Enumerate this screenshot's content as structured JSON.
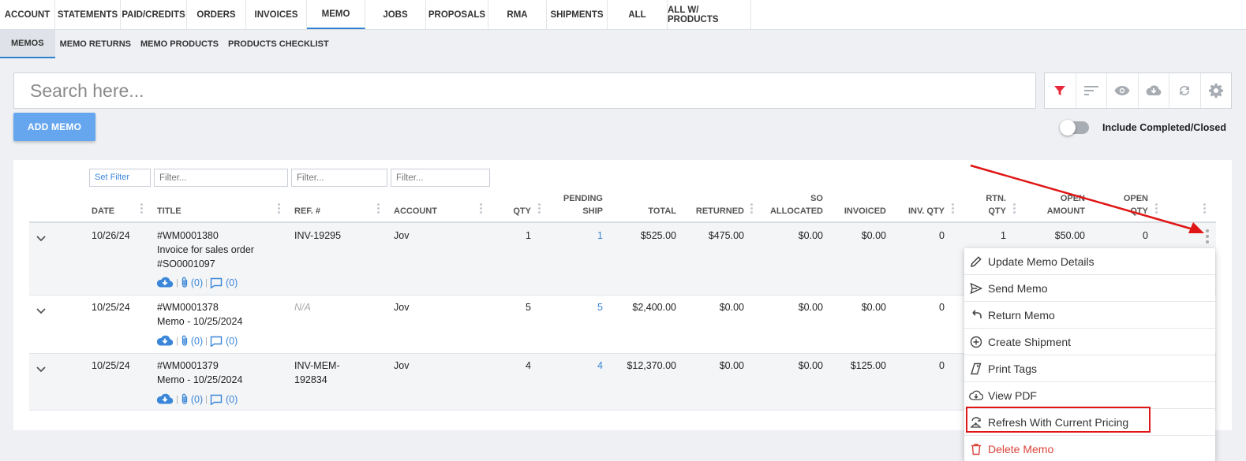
{
  "top_tabs": [
    "ACCOUNT",
    "STATEMENTS",
    "PAID/CREDITS",
    "ORDERS",
    "INVOICES",
    "MEMO",
    "JOBS",
    "PROPOSALS",
    "RMA",
    "SHIPMENTS",
    "ALL",
    "ALL W/ PRODUCTS"
  ],
  "active_top_tab": "MEMO",
  "sub_tabs": [
    "MEMOS",
    "MEMO RETURNS",
    "MEMO PRODUCTS",
    "PRODUCTS CHECKLIST"
  ],
  "active_sub_tab": "MEMOS",
  "search": {
    "placeholder": "Search here..."
  },
  "toolbar": {
    "icons": [
      "filter-icon",
      "sort-icon",
      "eye-icon",
      "cloud-download-icon",
      "refresh-icon",
      "gear-icon"
    ],
    "accent": "#e8283c"
  },
  "add_button": "ADD MEMO",
  "toggle_label": "Include Completed/Closed",
  "filters": {
    "set_filter": "Set Filter",
    "placeholder": "Filter..."
  },
  "columns": {
    "date": "DATE",
    "title": "TITLE",
    "ref": "REF. #",
    "account": "ACCOUNT",
    "qty": "QTY",
    "pending_ship_1": "PENDING",
    "pending_ship_2": "SHIP",
    "total": "TOTAL",
    "returned": "RETURNED",
    "so_allocated_1": "SO",
    "so_allocated_2": "ALLOCATED",
    "invoiced": "INVOICED",
    "inv_qty": "INV. QTY",
    "rtn_qty_1": "RTN.",
    "rtn_qty_2": "QTY",
    "open_amount_1": "OPEN",
    "open_amount_2": "AMOUNT",
    "open_qty_1": "OPEN",
    "open_qty_2": "QTY"
  },
  "rows": [
    {
      "date": "10/26/24",
      "title_1": "#WM0001380",
      "title_2": "Invoice for sales order",
      "title_3": "#SO0001097",
      "ref": "INV-19295",
      "ref_2": "",
      "account": "Jov",
      "qty": "1",
      "pending_ship": "1",
      "total": "$525.00",
      "returned": "$475.00",
      "so_allocated": "$0.00",
      "invoiced": "$0.00",
      "inv_qty": "0",
      "rtn_qty": "1",
      "open_amount": "$50.00",
      "open_qty": "0",
      "attachments": "(0)",
      "comments": "(0)"
    },
    {
      "date": "10/25/24",
      "title_1": "#WM0001378",
      "title_2": "Memo - 10/25/2024",
      "title_3": "",
      "ref": "N/A",
      "ref_2": "",
      "account": "Jov",
      "qty": "5",
      "pending_ship": "5",
      "total": "$2,400.00",
      "returned": "$0.00",
      "so_allocated": "$0.00",
      "invoiced": "$0.00",
      "inv_qty": "0",
      "attachments": "(0)",
      "comments": "(0)"
    },
    {
      "date": "10/25/24",
      "title_1": "#WM0001379",
      "title_2": "Memo - 10/25/2024",
      "title_3": "",
      "ref": "INV-MEM-",
      "ref_2": "192834",
      "account": "Jov",
      "qty": "4",
      "pending_ship": "4",
      "total": "$12,370.00",
      "returned": "$0.00",
      "so_allocated": "$0.00",
      "invoiced": "$125.00",
      "inv_qty": "0",
      "attachments": "(0)",
      "comments": "(0)"
    }
  ],
  "context_menu": [
    {
      "label": "Update Memo Details",
      "icon": "pencil-icon"
    },
    {
      "label": "Send Memo",
      "icon": "send-icon"
    },
    {
      "label": "Return Memo",
      "icon": "undo-icon"
    },
    {
      "label": "Create Shipment",
      "icon": "plus-circle-icon"
    },
    {
      "label": "Print Tags",
      "icon": "tag-icon"
    },
    {
      "label": "View PDF",
      "icon": "cloud-download-icon"
    },
    {
      "label": "Refresh With Current Pricing",
      "icon": "refresh-price-icon"
    },
    {
      "label": "Delete Memo",
      "icon": "trash-icon"
    }
  ],
  "colors": {
    "link_blue": "#3a86d8",
    "primary_button": "#66a6ef",
    "highlight_red": "#e01515",
    "delete_red": "#d9443a"
  }
}
